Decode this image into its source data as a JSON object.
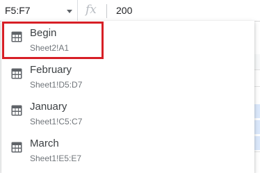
{
  "formula_bar": {
    "name_box": "F5:F7",
    "fx": "fx",
    "value": "200"
  },
  "named_ranges": [
    {
      "name": "Begin",
      "reference": "Sheet2!A1"
    },
    {
      "name": "February",
      "reference": "Sheet1!D5:D7"
    },
    {
      "name": "January",
      "reference": "Sheet1!C5:C7"
    },
    {
      "name": "March",
      "reference": "Sheet1!E5:E7"
    }
  ],
  "highlight_color": "#d71f26",
  "icon": "table-grid-icon"
}
